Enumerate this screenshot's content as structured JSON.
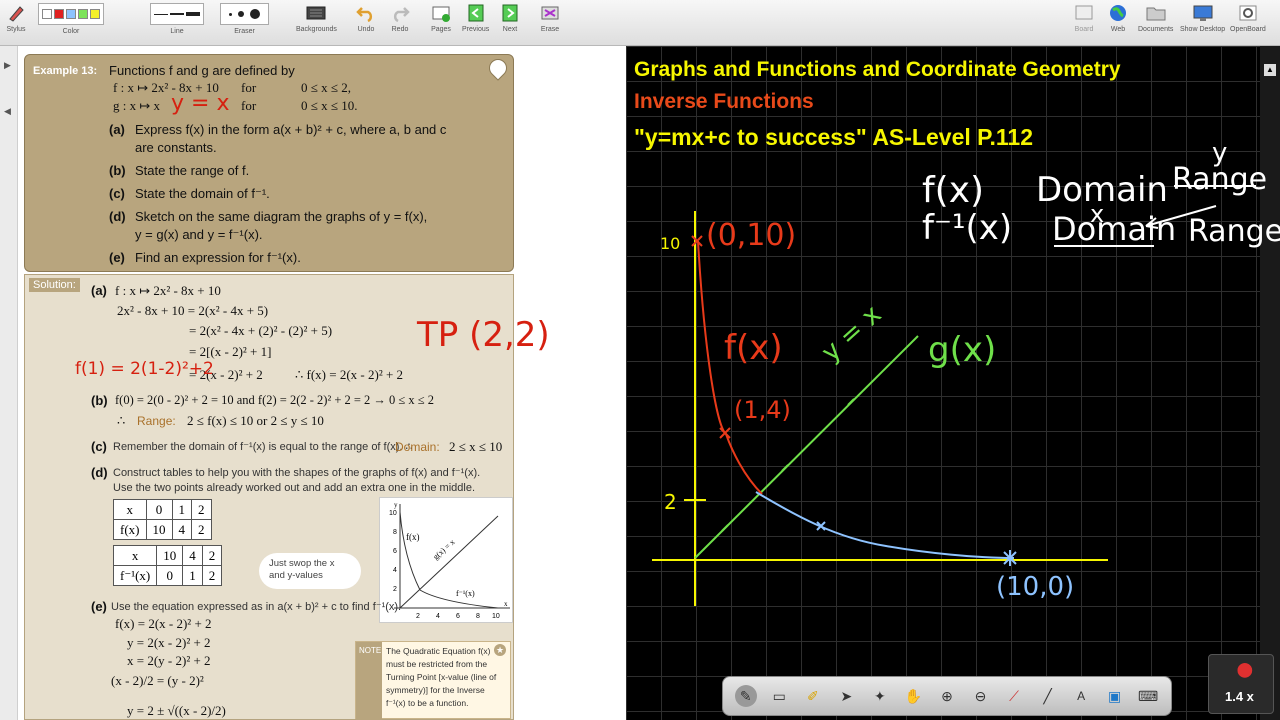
{
  "toolbar": {
    "stylus": "Stylus",
    "color": "Color",
    "line": "Line",
    "eraser": "Eraser",
    "backgrounds": "Backgrounds",
    "undo": "Undo",
    "redo": "Redo",
    "pages": "Pages",
    "previous": "Previous",
    "next": "Next",
    "erase": "Erase",
    "board": "Board",
    "web": "Web",
    "documents": "Documents",
    "show_desktop": "Show Desktop",
    "openboard": "OpenBoard",
    "swatch_colors": [
      "#ffffff",
      "#e02020",
      "#8ec3ff",
      "#7de35a",
      "#f4f02a"
    ]
  },
  "example": {
    "tag": "Example 13:",
    "intro": "Functions f and g are defined by",
    "f_def": "f : x ↦ 2x² - 8x + 10",
    "f_for": "for",
    "f_domain": "0 ≤ x ≤ 2,",
    "g_def": "g : x ↦ x",
    "g_hand": "y = x",
    "g_for": "for",
    "g_domain": "0 ≤ x ≤ 10.",
    "parts": [
      {
        "label": "(a)",
        "text1": "Express f(x) in the form a(x + b)² + c, where a, b and c",
        "text2": "are constants."
      },
      {
        "label": "(b)",
        "text1": "State the range of f.",
        "text2": ""
      },
      {
        "label": "(c)",
        "text1": "State the domain of f⁻¹.",
        "text2": ""
      },
      {
        "label": "(d)",
        "text1": "Sketch on the same diagram the graphs of y = f(x),",
        "text2": "y = g(x) and y = f⁻¹(x)."
      },
      {
        "label": "(e)",
        "text1": "Find an expression for f⁻¹(x).",
        "text2": ""
      }
    ]
  },
  "solution": {
    "tag": "Solution:",
    "a_label": "(a)",
    "a_lines": [
      "f : x ↦ 2x² - 8x + 10",
      "2x² - 8x + 10 = 2(x² - 4x + 5)",
      "= 2(x² - 4x + (2)² - (2)² + 5)",
      "= 2[(x - 2)² + 1]",
      "= 2(x - 2)² + 2"
    ],
    "a_therefore": "∴  f(x) = 2(x - 2)² + 2",
    "tp_hand": "TP (2,2)",
    "f1_hand": "f(1) = 2(1-2)²+2",
    "b_label": "(b)",
    "b_line1": "f(0) = 2(0 - 2)² + 2 = 10   and   f(2) = 2(2 - 2)² + 2 = 2  → 0 ≤ x ≤ 2",
    "b_range_pre": "∴",
    "b_range_label": "Range:",
    "b_range": "2 ≤ f(x) ≤ 10   or   2 ≤ y ≤ 10",
    "c_label": "(c)",
    "c_text": "Remember the domain of f⁻¹(x) is equal to the range of f(x).  ∴",
    "c_domain_label": "Domain:",
    "c_domain": "2 ≤ x ≤ 10",
    "d_label": "(d)",
    "d_text1": "Construct tables to help you with the shapes of the graphs of f(x) and f⁻¹(x).",
    "d_text2": "Use the two points already worked out and add an extra one in the middle.",
    "table1": {
      "h": [
        "x",
        "0",
        "1",
        "2"
      ],
      "r": [
        "f(x)",
        "10",
        "4",
        "2"
      ]
    },
    "table2": {
      "h": [
        "x",
        "10",
        "4",
        "2"
      ],
      "r": [
        "f⁻¹(x)",
        "0",
        "1",
        "2"
      ]
    },
    "bubble": "Just swop the x and y-values",
    "e_label": "(e)",
    "e_text": "Use the equation expressed as in a(x + b)² + c to find f⁻¹(x).",
    "e_lines": [
      "f(x) = 2(x - 2)² + 2",
      "y = 2(x - 2)² + 2",
      "x = 2(y - 2)² + 2",
      "(x - 2)/2 = (y - 2)²",
      "y = 2 ± √((x - 2)/2)"
    ],
    "note_tag": "NOTE",
    "note": [
      "The Quadratic Equation f(x)",
      "must be restricted from the",
      "Turning Point [x-value (line of",
      "symmetry)] for the Inverse",
      "f⁻¹(x) to be a function."
    ]
  },
  "mini_graph": {
    "f_label": "f(x)",
    "g_label": "g(x) = x",
    "finv_label": "f⁻¹(x)",
    "y_label": "y",
    "x_label": "x",
    "ticks": [
      "2",
      "4",
      "6",
      "8",
      "10"
    ],
    "yticks": [
      "10",
      "8",
      "6",
      "4",
      "2"
    ]
  },
  "board": {
    "title1": "Graphs and Functions and Coordinate Geometry",
    "title2": "Inverse Functions",
    "title3": "\"y=mx+c to success\"  AS-Level P.112",
    "title1_color": "#f6f600",
    "title2_color": "#e84a1a",
    "title3_color": "#f6f600",
    "notes": {
      "fx": "f(x)",
      "finv": "f⁻¹(x)",
      "domain": "Domain",
      "domain2": "Domain",
      "range": "Range",
      "range2": "Range",
      "x": "x",
      "y": "y"
    },
    "labels": {
      "p010": "(0,10)",
      "y10": "10",
      "fx": "f(x)",
      "p14": "(1,4)",
      "y2": "2",
      "yx": "y = x",
      "gx": "g(x)",
      "p100": "(10,0)"
    }
  },
  "zoom": "1.4 x"
}
